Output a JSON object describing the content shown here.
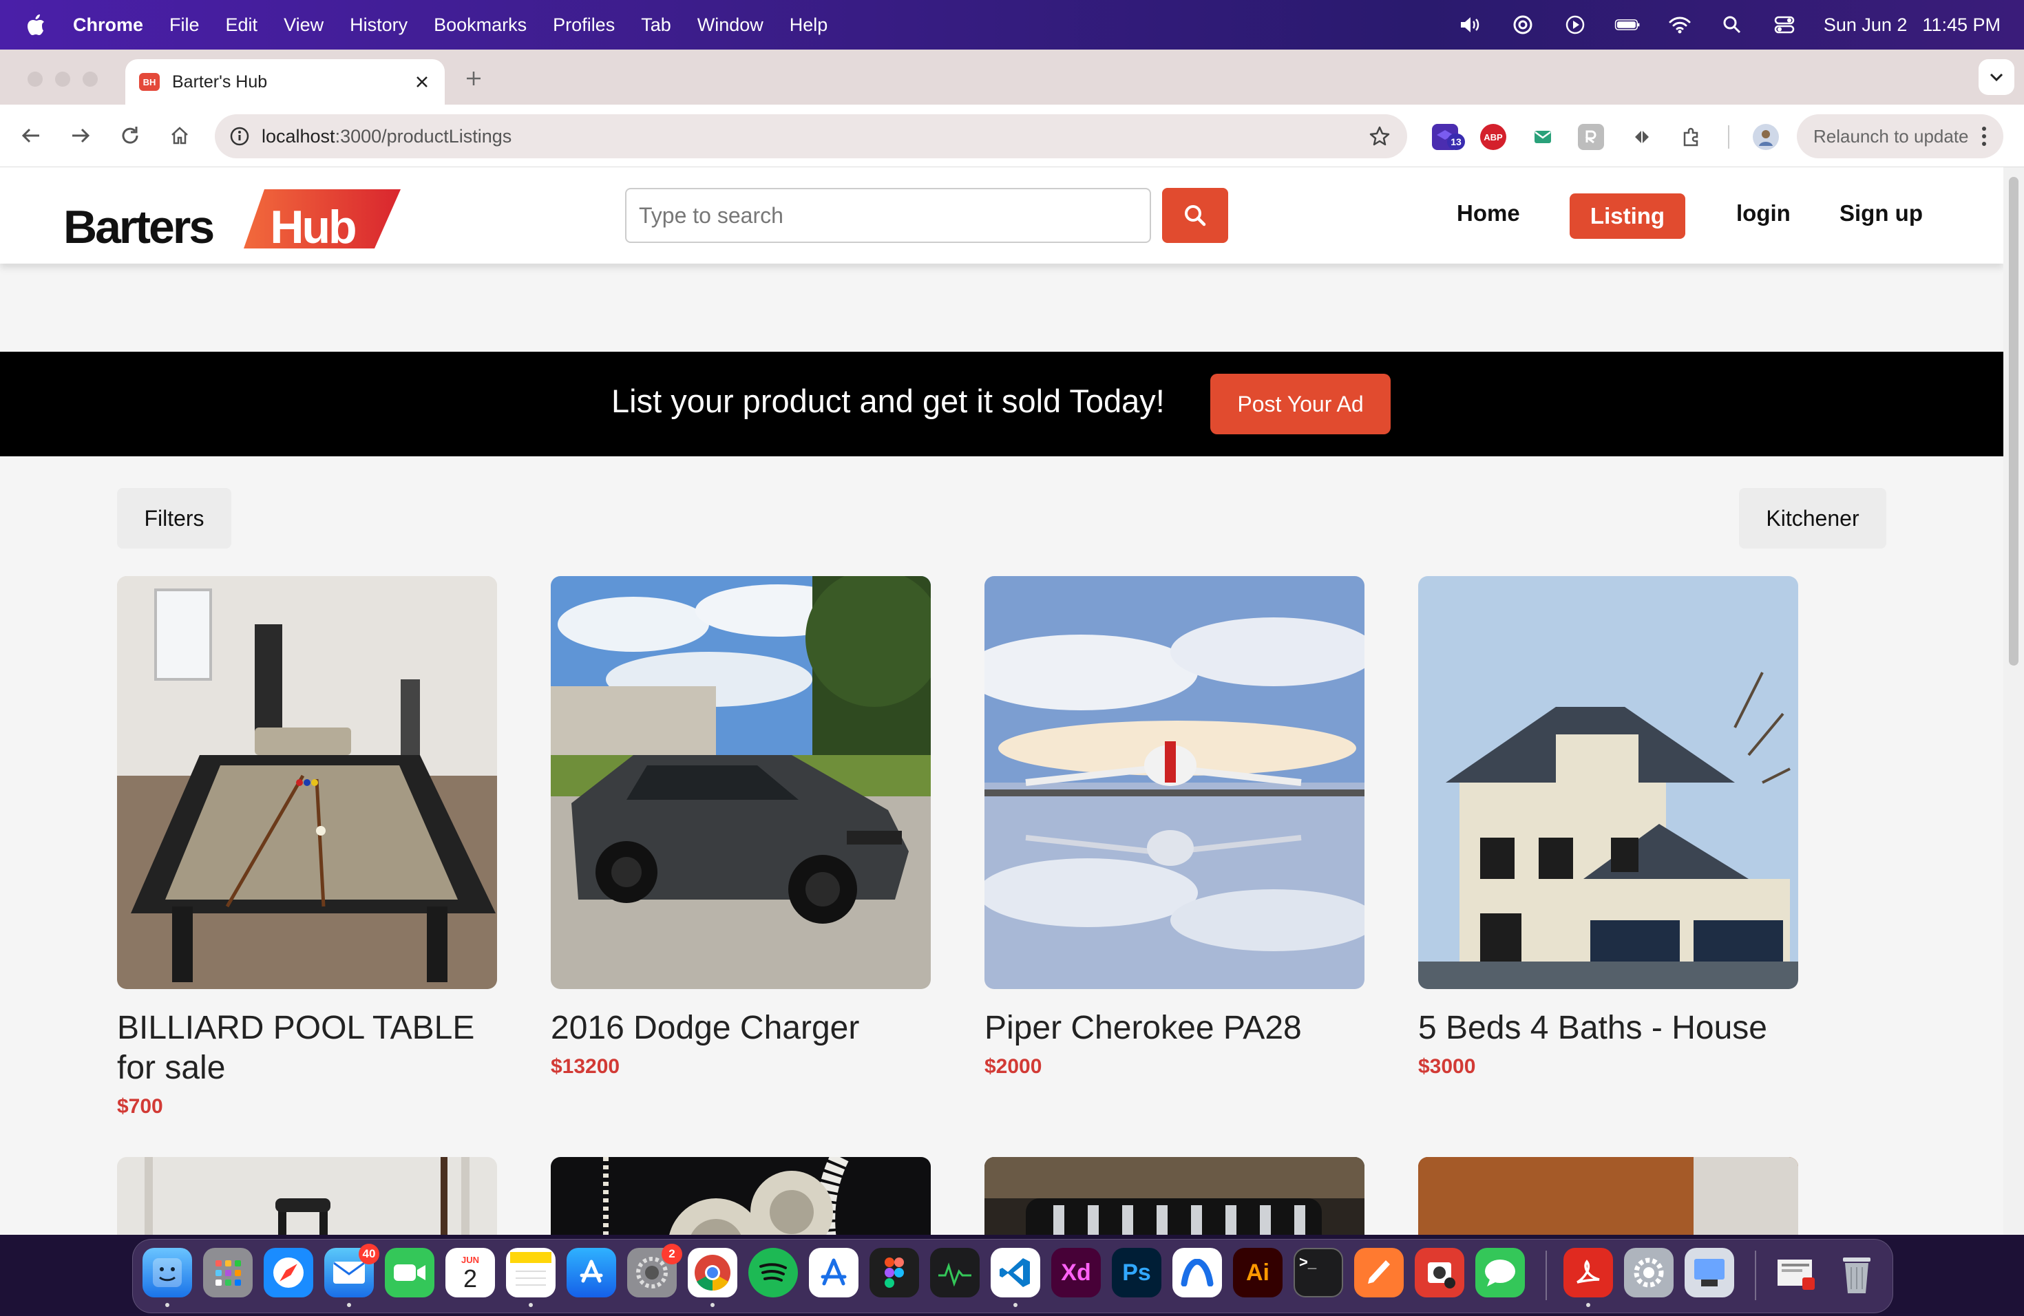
{
  "menubar": {
    "app_name": "Chrome",
    "items": [
      "File",
      "Edit",
      "View",
      "History",
      "Bookmarks",
      "Profiles",
      "Tab",
      "Window",
      "Help"
    ],
    "date": "Sun Jun 2",
    "time": "11:45 PM"
  },
  "browser": {
    "tab_title": "Barter's Hub",
    "tab_favicon": "BH",
    "url_host": "localhost",
    "url_path": ":3000/productListings",
    "ext_badge": "13",
    "ext_abp": "ABP",
    "relaunch_label": "Relaunch to update"
  },
  "site": {
    "logo_part1": "Barters",
    "logo_part2": "Hub",
    "search_placeholder": "Type to search",
    "nav": {
      "home": "Home",
      "listing": "Listing",
      "login": "login",
      "signup": "Sign up"
    },
    "banner_text": "List your product and get it sold Today!",
    "post_ad_label": "Post Your Ad",
    "filters_label": "Filters",
    "location_label": "Kitchener",
    "accent_color": "#e14b2f",
    "price_color": "#d23a35"
  },
  "listings": [
    {
      "title": "BILLIARD POOL TABLE for sale",
      "price": "$700",
      "image": "pool-table"
    },
    {
      "title": "2016 Dodge Charger",
      "price": "$13200",
      "image": "car"
    },
    {
      "title": "Piper Cherokee PA28",
      "price": "$2000",
      "image": "airplane"
    },
    {
      "title": "5 Beds 4 Baths - House",
      "price": "$3000",
      "image": "house"
    }
  ],
  "listings_row2": [
    {
      "image": "luggage"
    },
    {
      "image": "jewelry"
    },
    {
      "image": "wrench-set"
    },
    {
      "image": "basket"
    }
  ],
  "dock": {
    "mail_badge": "40",
    "calendar_month": "JUN",
    "calendar_day": "2",
    "settings_badge": "2"
  }
}
